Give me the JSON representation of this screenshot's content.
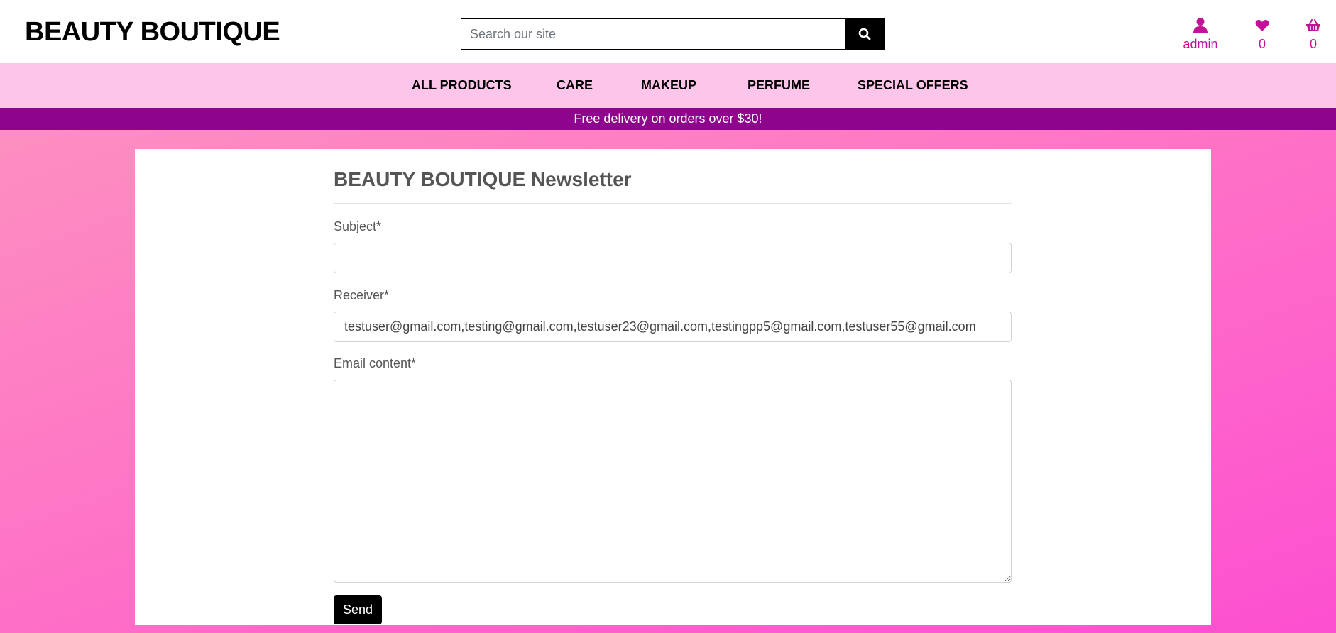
{
  "brand": {
    "name": "BEAUTY BOUTIQUE"
  },
  "search": {
    "placeholder": "Search our site",
    "icon": "search-icon"
  },
  "header_icons": {
    "account": {
      "icon": "user-icon",
      "label": "admin"
    },
    "wishlist": {
      "icon": "heart-icon",
      "count": "0"
    },
    "basket": {
      "icon": "basket-icon",
      "count": "0"
    }
  },
  "nav": {
    "items": [
      {
        "label": "ALL PRODUCTS"
      },
      {
        "label": "CARE"
      },
      {
        "label": "MAKEUP"
      },
      {
        "label": "PERFUME"
      },
      {
        "label": "SPECIAL OFFERS"
      }
    ]
  },
  "banner": {
    "text": "Free delivery on orders over $30!"
  },
  "form": {
    "title": "BEAUTY BOUTIQUE Newsletter",
    "subject_label": "Subject*",
    "subject_value": "",
    "receiver_label": "Receiver*",
    "receiver_value": "testuser@gmail.com,testing@gmail.com,testuser23@gmail.com,testingpp5@gmail.com,testuser55@gmail.com",
    "content_label": "Email content*",
    "content_value": "",
    "send_label": "Send"
  },
  "colors": {
    "accent": "#c0139a",
    "nav_bg": "#fdc5ea",
    "banner_bg": "#8e048c"
  }
}
